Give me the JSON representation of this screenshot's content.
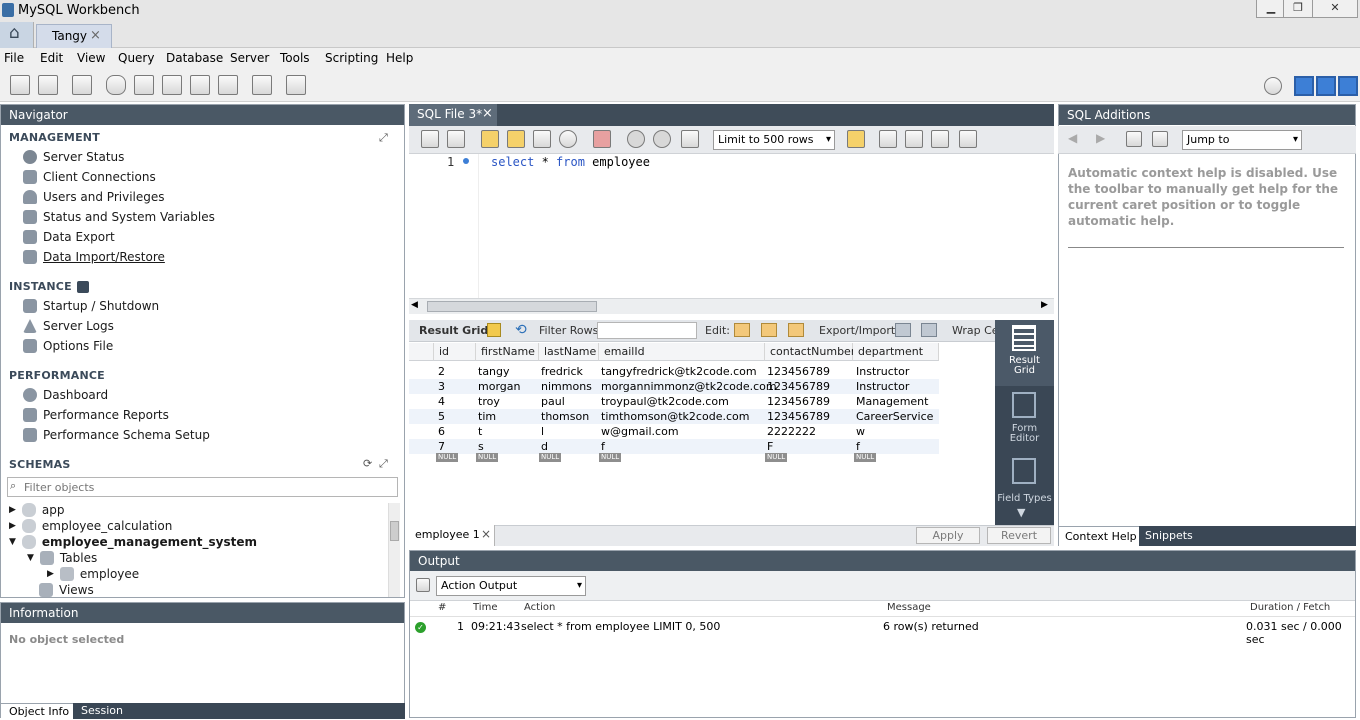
{
  "window": {
    "title": "MySQL Workbench",
    "min": "▁",
    "max": "❐",
    "close": "✕"
  },
  "tabs": {
    "home": "⌂",
    "connection": "Tangy",
    "connection_close": "×"
  },
  "menu": [
    "File",
    "Edit",
    "View",
    "Query",
    "Database",
    "Server",
    "Tools",
    "Scripting",
    "Help"
  ],
  "navigator": {
    "title": "Navigator",
    "management": {
      "label": "MANAGEMENT",
      "items": [
        "Server Status",
        "Client Connections",
        "Users and Privileges",
        "Status and System Variables",
        "Data Export",
        "Data Import/Restore"
      ]
    },
    "instance": {
      "label": "INSTANCE",
      "items": [
        "Startup / Shutdown",
        "Server Logs",
        "Options File"
      ]
    },
    "performance": {
      "label": "PERFORMANCE",
      "items": [
        "Dashboard",
        "Performance Reports",
        "Performance Schema Setup"
      ]
    },
    "schemas": {
      "label": "SCHEMAS",
      "filter_placeholder": "Filter objects",
      "tree": [
        "app",
        "employee_calculation",
        "employee_management_system",
        "Tables",
        "employee",
        "Views"
      ]
    }
  },
  "information": {
    "title": "Information",
    "empty": "No object selected",
    "tabs": [
      "Object Info",
      "Session"
    ]
  },
  "sql_editor": {
    "tab": "SQL File 3*",
    "tab_close": "×",
    "limit": "Limit to 500 rows",
    "line_no": "1",
    "query": {
      "kw1": "select",
      "mid": " * ",
      "kw2": "from",
      "rest": " employee"
    }
  },
  "result_toolbar": {
    "result_grid": "Result Grid",
    "filter_rows": "Filter Rows:",
    "edit": "Edit:",
    "export": "Export/Import:",
    "wrap": "Wrap Cel"
  },
  "grid": {
    "columns": [
      "id",
      "firstName",
      "lastName",
      "emailId",
      "contactNumber",
      "department"
    ],
    "rows": [
      [
        "2",
        "tangy",
        "fredrick",
        "tangyfredrick@tk2code.com",
        "123456789",
        "Instructor"
      ],
      [
        "3",
        "morgan",
        "nimmons",
        "morgannimmonz@tk2code.com",
        "123456789",
        "Instructor"
      ],
      [
        "4",
        "troy",
        "paul",
        "troypaul@tk2code.com",
        "123456789",
        "Management"
      ],
      [
        "5",
        "tim",
        "thomson",
        "timthomson@tk2code.com",
        "123456789",
        "CareerService"
      ],
      [
        "6",
        "t",
        "l",
        "w@gmail.com",
        "2222222",
        "w"
      ],
      [
        "7",
        "s",
        "d",
        "f",
        "F",
        "f"
      ]
    ],
    "null": "NULL"
  },
  "side_picker": {
    "result_grid": "Result Grid",
    "form_editor": "Form Editor",
    "field_types": "Field Types"
  },
  "result_tabs": {
    "tab": "employee 1",
    "close": "×",
    "apply": "Apply",
    "revert": "Revert"
  },
  "sql_additions": {
    "title": "SQL Additions",
    "jump_to": "Jump to",
    "help_text": "Automatic context help is disabled. Use the toolbar to manually get help for the current caret position or to toggle automatic help.",
    "tabs": [
      "Context Help",
      "Snippets"
    ]
  },
  "output": {
    "title": "Output",
    "mode": "Action Output",
    "columns": [
      "#",
      "Time",
      "Action",
      "Message",
      "Duration / Fetch"
    ],
    "rows": [
      [
        "1",
        "09:21:43",
        "select * from employee LIMIT 0, 500",
        "6 row(s) returned",
        "0.031 sec / 0.000 sec"
      ]
    ]
  },
  "colors": {
    "panel_header": "#4a5865",
    "accent": "#3a4755",
    "success": "#2ca02c"
  }
}
